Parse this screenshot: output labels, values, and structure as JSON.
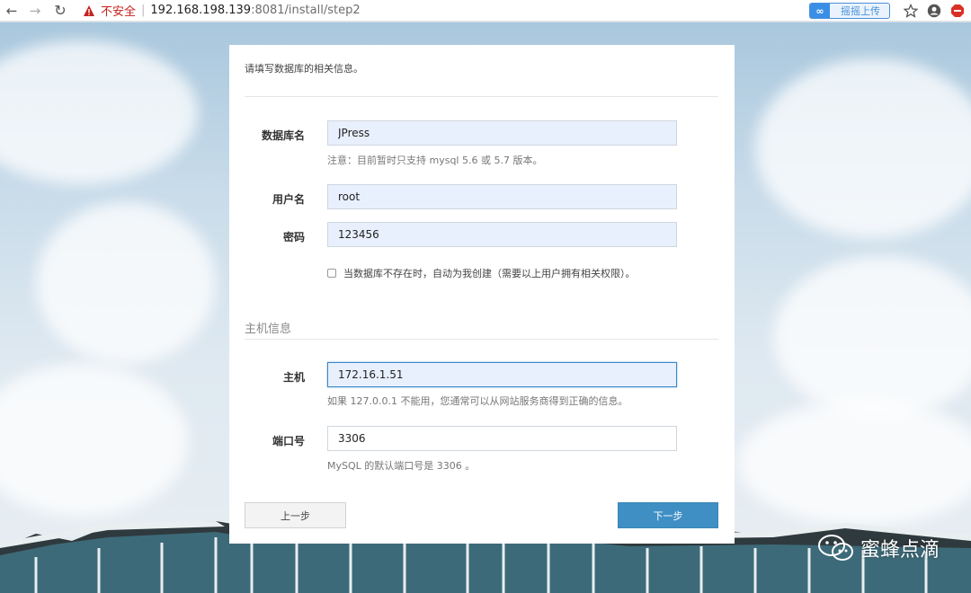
{
  "browser": {
    "insecure_label": "不安全",
    "url_host": "192.168.198.139",
    "url_rest": ":8081/install/step2",
    "extension_label": "摇摇上传"
  },
  "form": {
    "intro": "请填写数据库的相关信息。",
    "db_name": {
      "label": "数据库名",
      "value": "JPress",
      "hint": "注意：目前暂时只支持 mysql 5.6 或 5.7 版本。"
    },
    "username": {
      "label": "用户名",
      "value": "root"
    },
    "password": {
      "label": "密码",
      "value": "123456"
    },
    "auto_create": {
      "label": "当数据库不存在时，自动为我创建（需要以上用户拥有相关权限）。",
      "checked": false
    },
    "host_section_title": "主机信息",
    "host": {
      "label": "主机",
      "value": "172.16.1.51",
      "hint": "如果 127.0.0.1 不能用，您通常可以从网站服务商得到正确的信息。"
    },
    "port": {
      "label": "端口号",
      "value": "3306",
      "hint": "MySQL 的默认端口号是 3306 。"
    },
    "prev_button": "上一步",
    "next_button": "下一步"
  },
  "watermark": {
    "text": "蜜蜂点滴"
  },
  "colors": {
    "primary_button": "#3f8fc4",
    "autofill_input": "#e8f0fe",
    "insecure_red": "#c5221f"
  }
}
